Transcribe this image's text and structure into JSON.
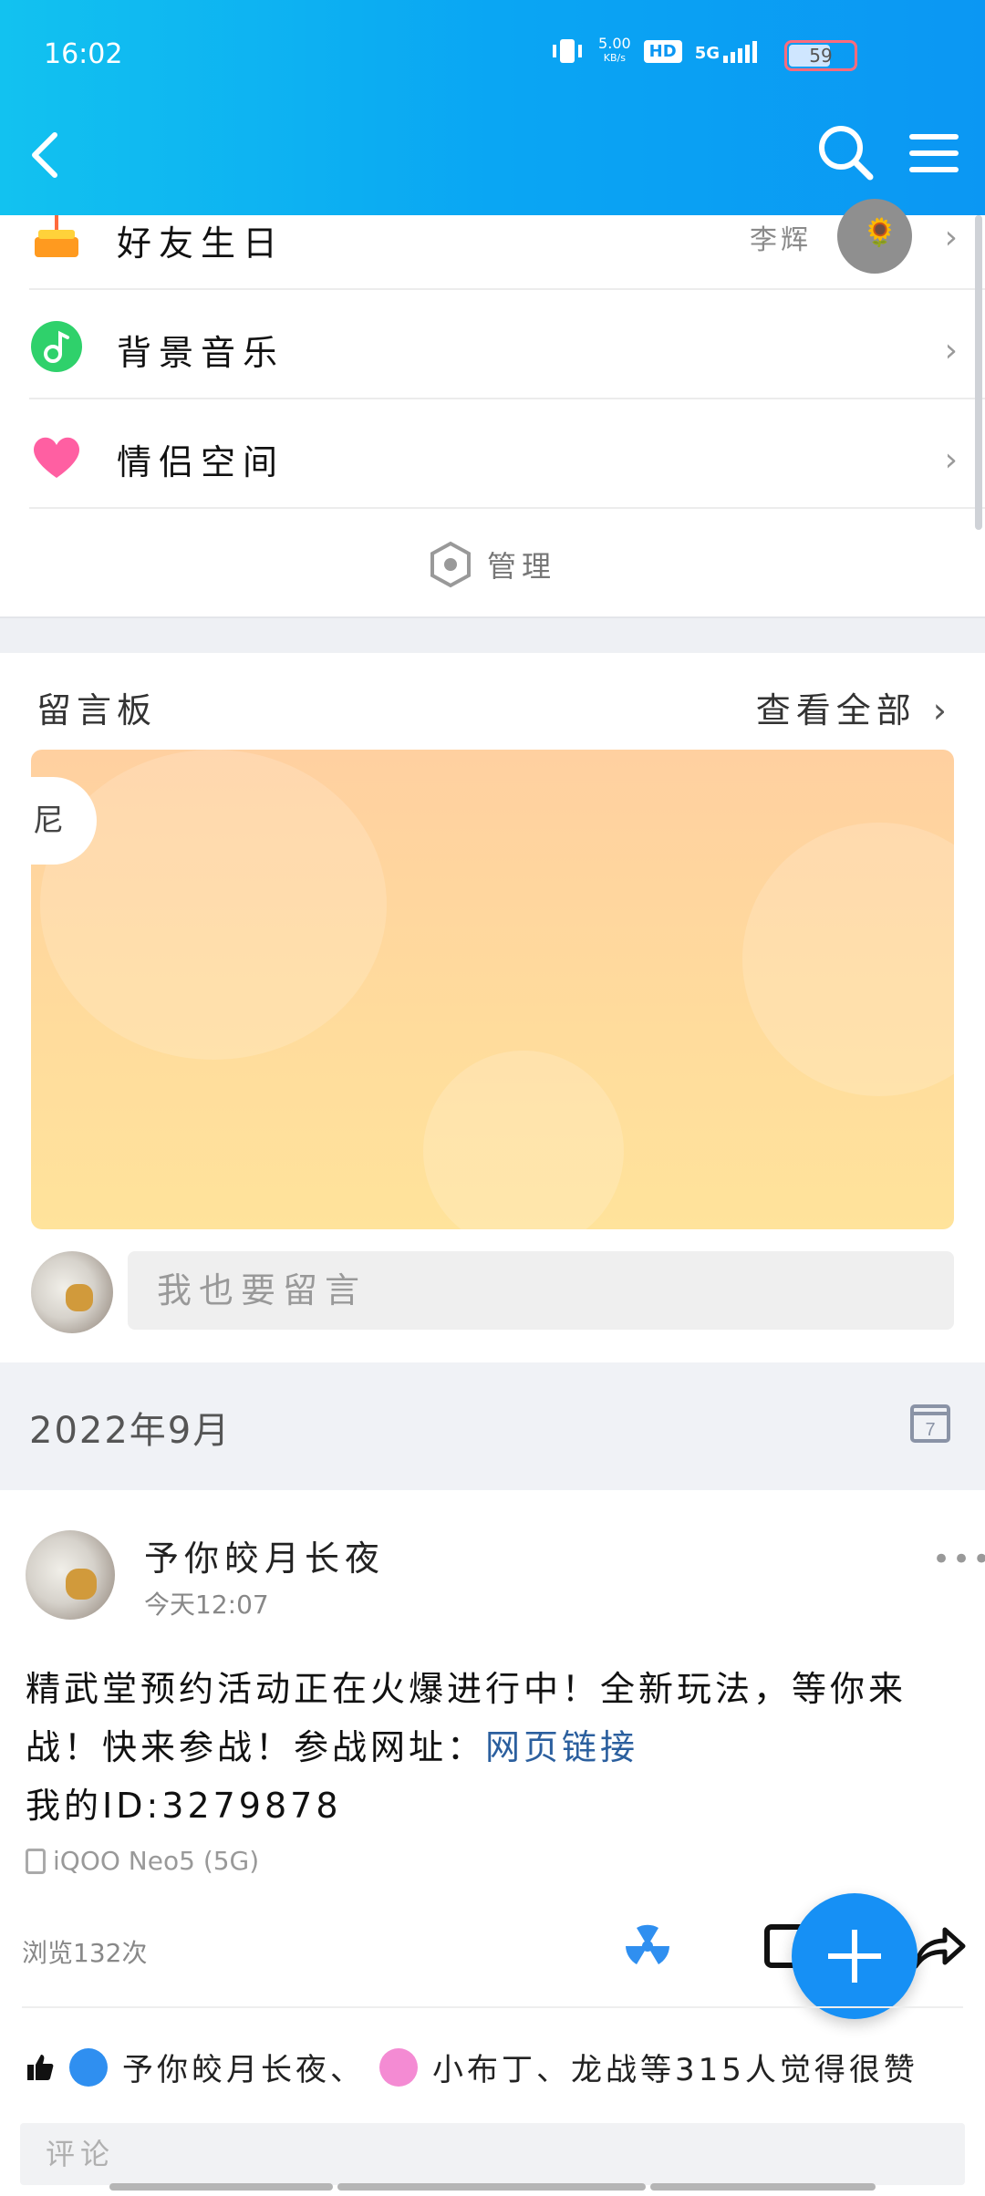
{
  "status_bar": {
    "time": "16:02",
    "net_speed_value": "5.00",
    "net_speed_unit": "KB/s",
    "hd": "HD",
    "network": "5G",
    "battery": "59"
  },
  "function_list": [
    {
      "label": "好友生日",
      "extra_text": "李辉",
      "icon": "cake-icon"
    },
    {
      "label": "背景音乐",
      "icon": "music-note-icon"
    },
    {
      "label": "情侣空间",
      "icon": "heart-icon"
    }
  ],
  "manage_label": "管理",
  "guestbook": {
    "title": "留言板",
    "view_all": "查看全部",
    "card_tag": "尼",
    "input_placeholder": "我也要留言"
  },
  "month_label": "2022年9月",
  "calendar_day": "7",
  "post": {
    "author": "予你皎月长夜",
    "time": "今天12:07",
    "text_before_link": "精武堂预约活动正在火爆进行中！全新玩法，等你来战！快来参战！参战网址：",
    "link_text": "网页链接",
    "text_line2": "我的ID:3279878",
    "device": "iQOO Neo5 (5G)",
    "views": "浏览132次",
    "likes_name1": "予你皎月长夜、",
    "likes_rest": "小布丁、龙战等315人觉得很赞",
    "comment_placeholder": "评论"
  },
  "colors": {
    "header_start": "#12c2f0",
    "header_end": "#0b97f3",
    "fab": "#1690f5",
    "link": "#2b5f9e"
  }
}
